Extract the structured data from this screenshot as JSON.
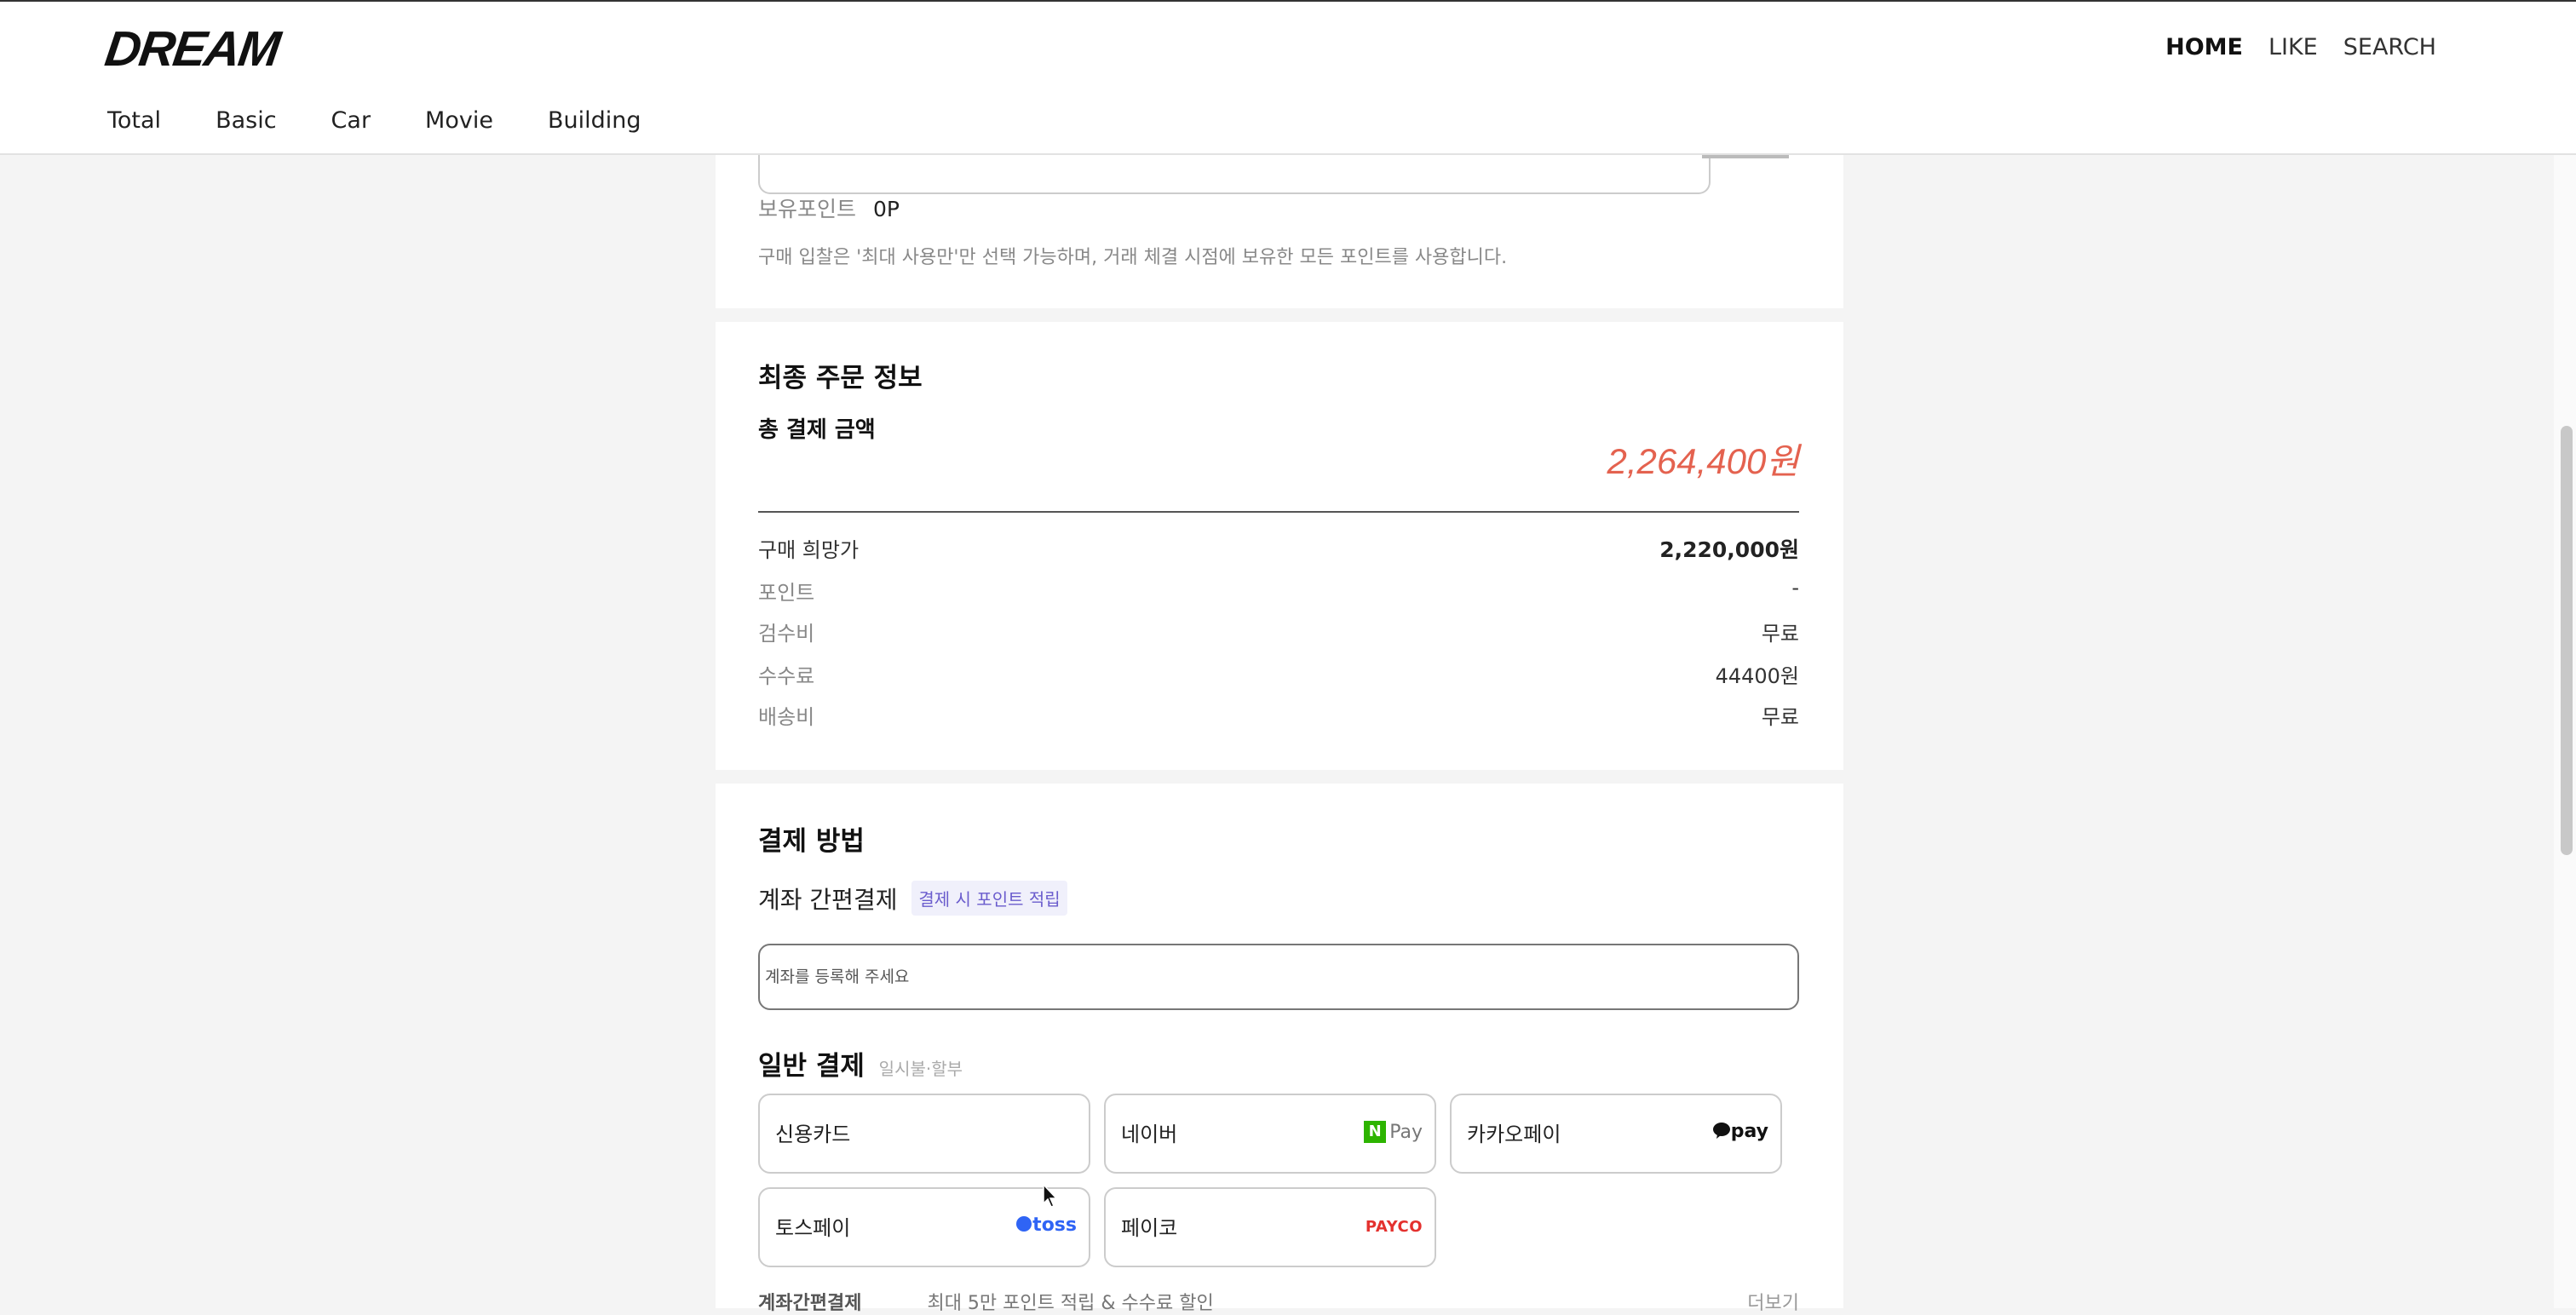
{
  "header": {
    "logo": "DREAM",
    "top_nav": [
      "HOME",
      "LIKE",
      "SEARCH"
    ],
    "categories": [
      "Total",
      "Basic",
      "Car",
      "Movie",
      "Building"
    ]
  },
  "points": {
    "label": "보유포인트",
    "value": "0P",
    "note": "구매 입찰은 '최대 사용만'만 선택 가능하며, 거래 체결 시점에 보유한 모든 포인트를 사용합니다."
  },
  "order": {
    "title": "최종 주문 정보",
    "total_label": "총 결제 금액",
    "total_amount": "2,264,400원",
    "rows": [
      {
        "label": "구매 희망가",
        "value": "2,220,000원"
      },
      {
        "label": "포인트",
        "value": "-"
      },
      {
        "label": "검수비",
        "value": "무료"
      },
      {
        "label": "수수료",
        "value": "44400원"
      },
      {
        "label": "배송비",
        "value": "무료"
      }
    ]
  },
  "payment": {
    "title": "결제 방법",
    "account_title": "계좌 간편결제",
    "account_badge": "결제 시 포인트 적립",
    "account_placeholder": "계좌를 등록해 주세요",
    "general_title": "일반 결제",
    "general_sub": "일시불·할부",
    "methods": [
      {
        "name": "신용카드",
        "logo": ""
      },
      {
        "name": "네이버",
        "logo": "Pay",
        "logo_mark": "N"
      },
      {
        "name": "카카오페이",
        "logo": "pay"
      },
      {
        "name": "토스페이",
        "logo": "toss"
      },
      {
        "name": "페이코",
        "logo": "PAYCO"
      }
    ],
    "bottom_label": "계좌간편결제",
    "bottom_desc": "최대 5만 포인트 적립 & 수수료 할인",
    "bottom_more": "더보기"
  },
  "colors": {
    "accent_total": "#e4624f",
    "badge_text": "#6a5ccd",
    "naver_green": "#2db400",
    "toss_blue": "#2f64f5",
    "payco_red": "#e4312e"
  }
}
